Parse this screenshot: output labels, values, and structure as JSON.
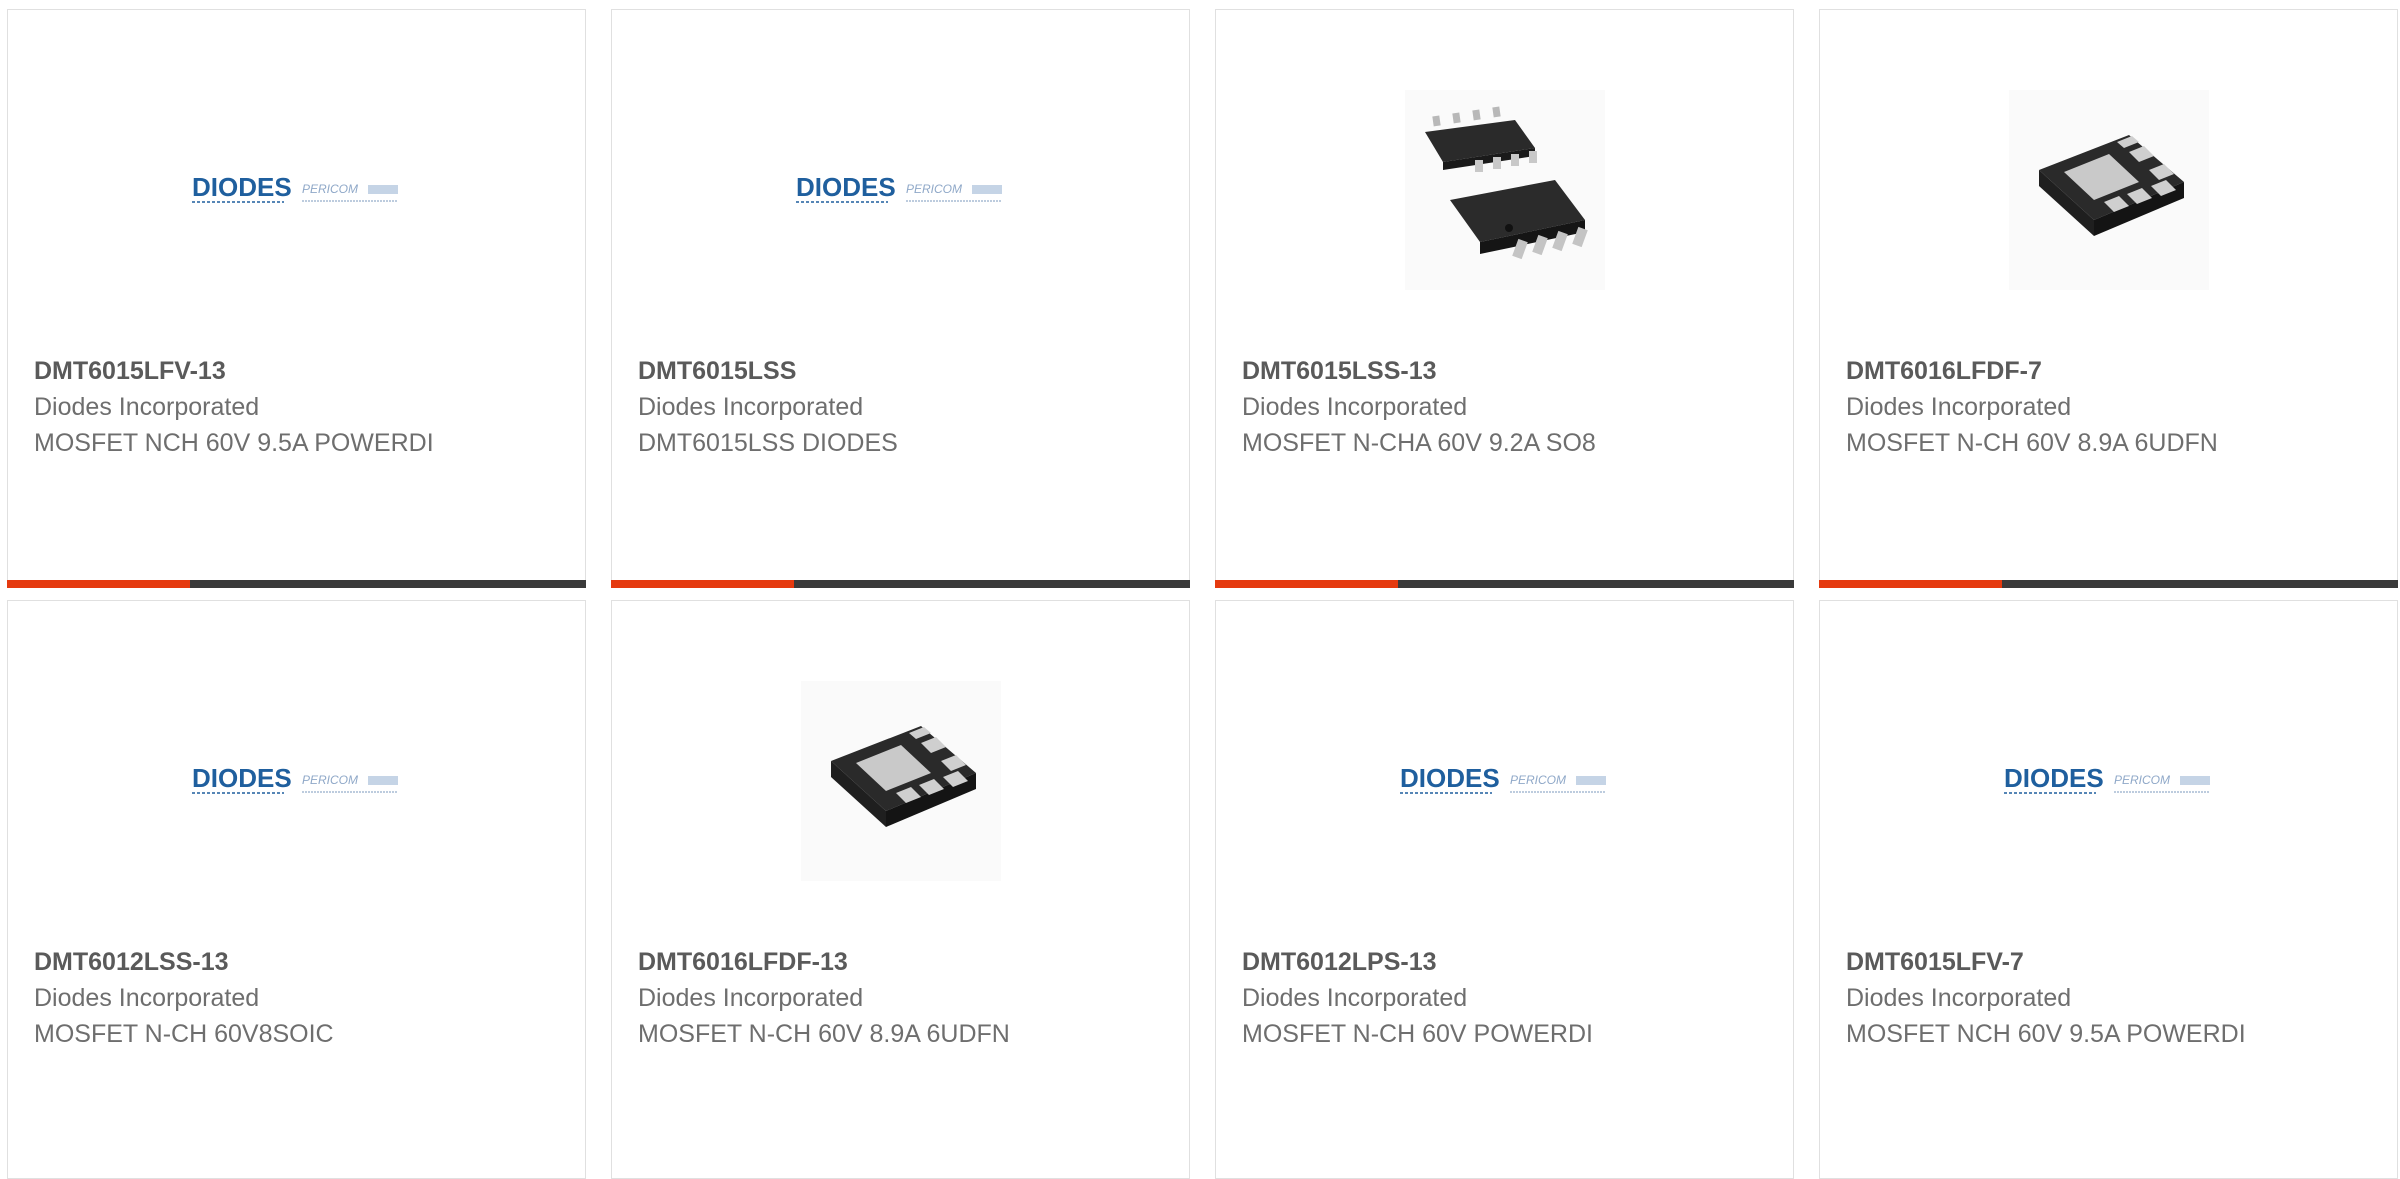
{
  "products": [
    {
      "part_number": "DMT6015LFV-13",
      "manufacturer": "Diodes Incorporated",
      "description": "MOSFET NCH 60V 9.5A POWERDI",
      "image": "diodes-logo"
    },
    {
      "part_number": "DMT6015LSS",
      "manufacturer": "Diodes Incorporated",
      "description": "DMT6015LSS DIODES",
      "image": "diodes-logo"
    },
    {
      "part_number": "DMT6015LSS-13",
      "manufacturer": "Diodes Incorporated",
      "description": "MOSFET N-CHA 60V 9.2A SO8",
      "image": "so8-package"
    },
    {
      "part_number": "DMT6016LFDF-7",
      "manufacturer": "Diodes Incorporated",
      "description": "MOSFET N-CH 60V 8.9A 6UDFN",
      "image": "udfn-package"
    },
    {
      "part_number": "DMT6012LSS-13",
      "manufacturer": "Diodes Incorporated",
      "description": "MOSFET N-CH 60V8SOIC",
      "image": "diodes-logo"
    },
    {
      "part_number": "DMT6016LFDF-13",
      "manufacturer": "Diodes Incorporated",
      "description": "MOSFET N-CH 60V 8.9A 6UDFN",
      "image": "udfn-package"
    },
    {
      "part_number": "DMT6012LPS-13",
      "manufacturer": "Diodes Incorporated",
      "description": "MOSFET N-CH 60V POWERDI",
      "image": "diodes-logo"
    },
    {
      "part_number": "DMT6015LFV-7",
      "manufacturer": "Diodes Incorporated",
      "description": "MOSFET NCH 60V 9.5A POWERDI",
      "image": "diodes-logo"
    }
  ],
  "logo": {
    "primary": "DIODES",
    "secondary": "PERICOM"
  },
  "colors": {
    "accent": "#e53a0f",
    "bar": "#3a3a3a",
    "logo_blue": "#1f5f9e",
    "logo_light": "#8fa8c8"
  }
}
